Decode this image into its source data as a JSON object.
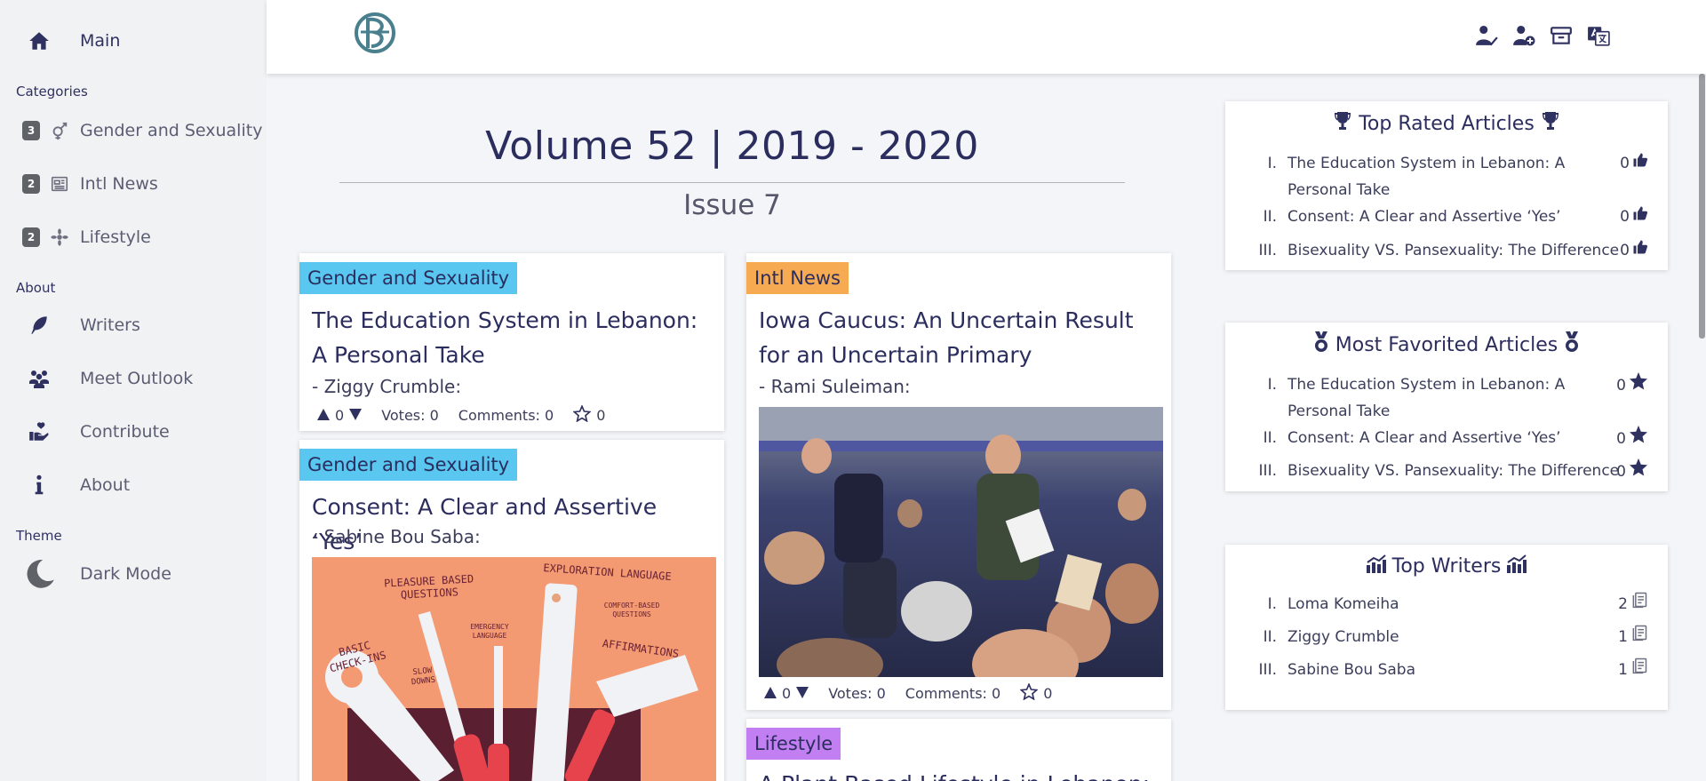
{
  "sidebar": {
    "main_label": "Main",
    "categories_heading": "Categories",
    "categories": [
      {
        "count": "3",
        "label": "Gender and Sexuality",
        "icon": "gender-icon"
      },
      {
        "count": "2",
        "label": "Intl News",
        "icon": "newspaper-icon"
      },
      {
        "count": "2",
        "label": "Lifestyle",
        "icon": "spa-icon"
      }
    ],
    "about_heading": "About",
    "about_items": [
      {
        "label": "Writers",
        "icon": "feather-icon"
      },
      {
        "label": "Meet Outlook",
        "icon": "team-icon"
      },
      {
        "label": "Contribute",
        "icon": "hand-heart-icon"
      },
      {
        "label": "About",
        "icon": "info-icon"
      }
    ],
    "theme_heading": "Theme",
    "dark_mode_label": "Dark Mode"
  },
  "header": {
    "icons": [
      "user-check-icon",
      "user-plus-icon",
      "archive-icon",
      "translate-icon"
    ]
  },
  "main": {
    "volume_title": "Volume 52 | 2019 - 2020",
    "issue_title": "Issue 7",
    "articles": [
      {
        "category": "Gender and Sexuality",
        "title": "The Education System in Lebanon: A Personal Take",
        "author": "- Ziggy Crumble:",
        "upvotes": "0",
        "votes": "Votes: 0",
        "comments": "Comments: 0",
        "favorites": "0"
      },
      {
        "category": "Intl News",
        "title": "Iowa Caucus: An Uncertain Result for an Uncertain Primary",
        "author": "- Rami Suleiman:",
        "upvotes": "0",
        "votes": "Votes: 0",
        "comments": "Comments: 0",
        "favorites": "0"
      },
      {
        "category": "Gender and Sexuality",
        "title": "Consent: A Clear and Assertive ‘Yes’",
        "author": "- Sabine Bou Saba:"
      },
      {
        "category": "Lifestyle",
        "title": "A Plant-Based Lifestyle in Lebanon:"
      }
    ],
    "illustration_words": [
      "PLEASURE BASED QUESTIONS",
      "EXPLORATION LANGUAGE",
      "COMFORT-BASED QUESTIONS",
      "EMERGENCY LANGUAGE",
      "BASIC CHECK-INS",
      "SLOW DOWNS",
      "AFFIRMATIONS"
    ]
  },
  "right": {
    "top_rated": {
      "title": "Top Rated Articles",
      "rows": [
        {
          "num": "I.",
          "text": "The Education System in Lebanon: A Personal Take",
          "count": "0"
        },
        {
          "num": "II.",
          "text": "Consent: A Clear and Assertive ‘Yes’",
          "count": "0"
        },
        {
          "num": "III.",
          "text": "Bisexuality VS. Pansexuality: The Difference",
          "count": "0"
        }
      ]
    },
    "most_favorited": {
      "title": "Most Favorited Articles",
      "rows": [
        {
          "num": "I.",
          "text": "The Education System in Lebanon: A Personal Take",
          "count": "0"
        },
        {
          "num": "II.",
          "text": "Consent: A Clear and Assertive ‘Yes’",
          "count": "0"
        },
        {
          "num": "III.",
          "text": "Bisexuality VS. Pansexuality: The Difference",
          "count": "0"
        }
      ]
    },
    "top_writers": {
      "title": "Top Writers",
      "rows": [
        {
          "num": "I.",
          "text": "Loma Komeiha",
          "count": "2"
        },
        {
          "num": "II.",
          "text": "Ziggy Crumble",
          "count": "1"
        },
        {
          "num": "III.",
          "text": "Sabine Bou Saba",
          "count": "1"
        }
      ]
    }
  },
  "colors": {
    "accent": "#2f3161",
    "gender_tag": "#59c7ef",
    "intl_tag": "#f6aa52",
    "lifestyle_tag": "#c27ff1"
  }
}
